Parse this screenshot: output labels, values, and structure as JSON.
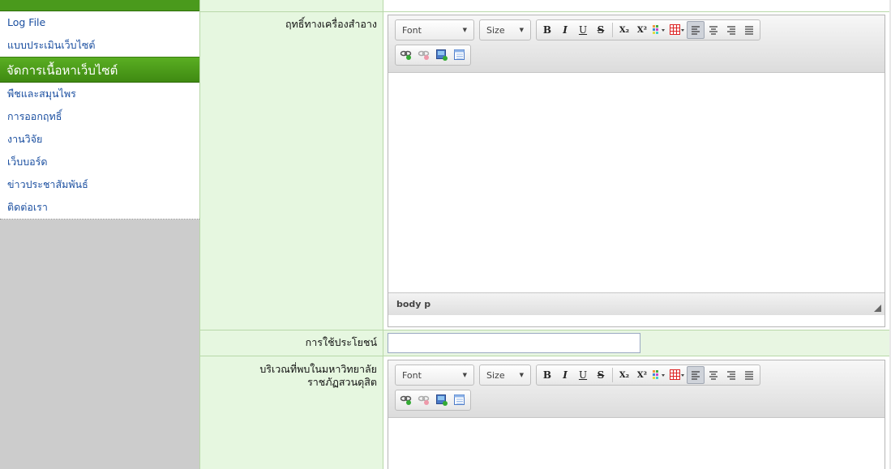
{
  "sidebar": {
    "top_links": [
      "Log File",
      "แบบประเมินเว็บไซต์"
    ],
    "section_title": "จัดการเนื้อหาเว็บไซต์",
    "section_links": [
      "พืชและสมุนไพร",
      "การออกฤทธิ์",
      "งานวิจัย",
      "เว็บบอร์ด",
      "ข่าวประชาสัมพันธ์",
      "ติดต่อเรา"
    ]
  },
  "form": {
    "field1_label": "ฤทธิ์ทางเครื่องสำอาง",
    "field2_label": "การใช้ประโยชน์",
    "field2_value": "",
    "field3_label_line1": "บริเวณที่พบในมหาวิทยาลัย",
    "field3_label_line2": "ราชภัฏสวนดุสิต"
  },
  "editor": {
    "font_combo": "Font",
    "size_combo": "Size",
    "status_path": "body  p",
    "buttons": {
      "bold": "B",
      "italic": "I",
      "underline": "U",
      "strike": "S",
      "subscript": "X₂",
      "superscript": "X²"
    },
    "icons": [
      "text-color-icon",
      "table-icon",
      "align-left-icon",
      "align-center-icon",
      "align-right-icon",
      "align-justify-icon",
      "link-icon",
      "unlink-icon",
      "image-icon",
      "template-icon"
    ]
  },
  "colors": {
    "sidebar_green": "#4a9a1c",
    "link_blue": "#1b4fa0",
    "label_bg": "#e6f7e0"
  }
}
